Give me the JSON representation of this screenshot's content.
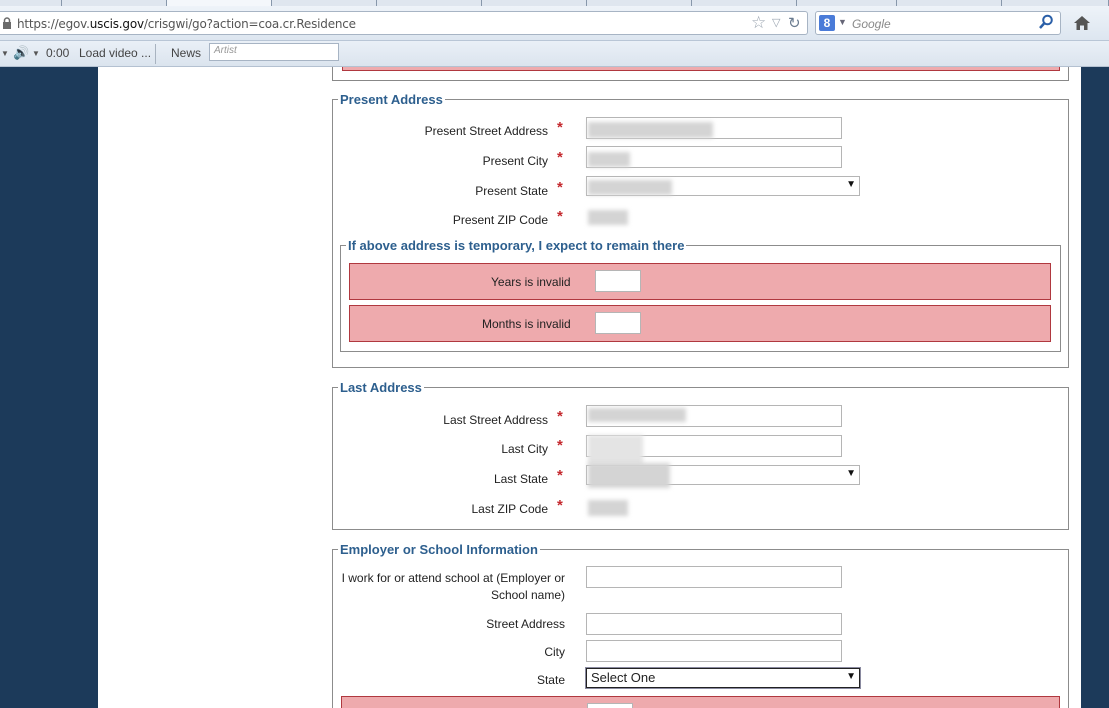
{
  "browser": {
    "url_host_prefix": "https://egov.",
    "url_host": "uscis.gov",
    "url_path": "/crisgwi/go?action=coa.cr.Residence",
    "search_engine_letter": "8",
    "search_placeholder": "Google",
    "media": {
      "time": "0:00",
      "load_video": "Load video ...",
      "news": "News",
      "artist_placeholder": "Artist"
    }
  },
  "form": {
    "present_address": {
      "legend": "Present Address",
      "street_label": "Present Street Address",
      "city_label": "Present City",
      "state_label": "Present State",
      "zip_label": "Present ZIP Code",
      "required_mark": "*",
      "temporary": {
        "legend": "If above address is temporary, I expect to remain there",
        "years_error": "Years is invalid",
        "months_error": "Months is invalid"
      }
    },
    "last_address": {
      "legend": "Last Address",
      "street_label": "Last Street Address",
      "city_label": "Last City",
      "state_label": "Last State",
      "zip_label": "Last ZIP Code",
      "required_mark": "*"
    },
    "employer": {
      "legend": "Employer or School Information",
      "name_label": "I work for or attend school at (Employer or School name)",
      "street_label": "Street Address",
      "city_label": "City",
      "state_label": "State",
      "state_value": "Select One"
    }
  }
}
